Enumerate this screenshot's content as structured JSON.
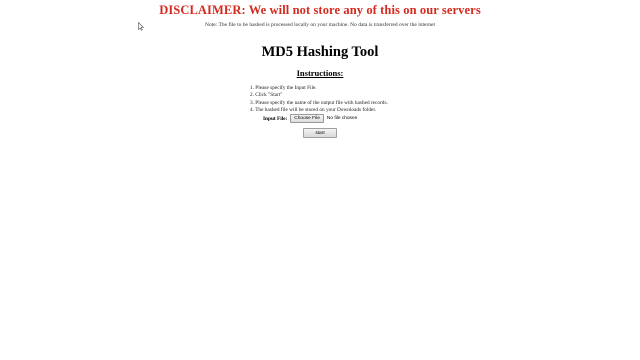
{
  "page": {
    "disclaimer": "DISCLAIMER: We will not store any of this on our servers",
    "note": "Note: The file to be hashed is processed locally on your machine. No data is transferred over the internet",
    "title": "MD5 Hashing Tool",
    "instructions_heading": "Instructions:",
    "steps": [
      "1. Please specify the Input File.",
      "2. Click \"Start\"",
      "3. Please specify the name of the output file with hashed records.",
      "4. The hashed file will be stored on your Downloads folder."
    ],
    "input_label": "Input File:",
    "choose_file_label": "Choose File",
    "no_file_text": "No file chosen",
    "start_label": "start"
  },
  "colors": {
    "disclaimer": "#d42a1f"
  },
  "icons": {
    "cursor": "mouse-pointer-icon"
  }
}
